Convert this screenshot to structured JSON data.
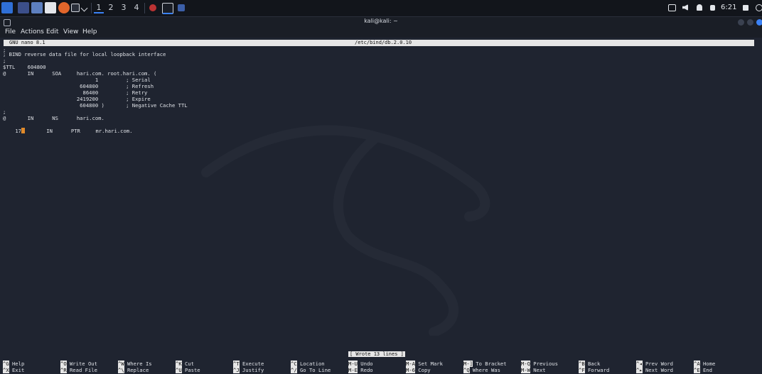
{
  "taskbar": {
    "workspaces": [
      "1",
      "2",
      "3",
      "4"
    ],
    "clock": "6:21"
  },
  "window": {
    "title": "kali@kali: ~",
    "menu": [
      "File",
      "Actions",
      "Edit",
      "View",
      "Help"
    ]
  },
  "nano": {
    "version": "GNU nano 8.1",
    "filename": "/etc/bind/db.2.0.10",
    "lines": [
      ";",
      "; BIND reverse data file for local loopback interface",
      ";",
      "$TTL    604800",
      "@       IN      SOA     hari.com. root.hari.com. (",
      "                              1         ; Serial",
      "                         604800         ; Refresh",
      "                          86400         ; Retry",
      "                        2419200         ; Expire",
      "                         604800 )       ; Negative Cache TTL",
      ";",
      "@       IN      NS      hari.com.",
      "IN      PTR     mr.hari.com."
    ],
    "ptr_prefix": "17",
    "status": "[ Wrote 13 lines ]",
    "shortcuts": [
      {
        "key1": "^G",
        "label1": "Help",
        "key2": "^X",
        "label2": "Exit"
      },
      {
        "key1": "^O",
        "label1": "Write Out",
        "key2": "^R",
        "label2": "Read File"
      },
      {
        "key1": "^W",
        "label1": "Where Is",
        "key2": "^\\",
        "label2": "Replace"
      },
      {
        "key1": "^K",
        "label1": "Cut",
        "key2": "^U",
        "label2": "Paste"
      },
      {
        "key1": "^T",
        "label1": "Execute",
        "key2": "^J",
        "label2": "Justify"
      },
      {
        "key1": "^C",
        "label1": "Location",
        "key2": "^/",
        "label2": "Go To Line"
      },
      {
        "key1": "M-U",
        "label1": "Undo",
        "key2": "M-E",
        "label2": "Redo"
      },
      {
        "key1": "M-A",
        "label1": "Set Mark",
        "key2": "M-6",
        "label2": "Copy"
      },
      {
        "key1": "M-]",
        "label1": "To Bracket",
        "key2": "^Q",
        "label2": "Where Was"
      },
      {
        "key1": "M-Q",
        "label1": "Previous",
        "key2": "M-W",
        "label2": "Next"
      },
      {
        "key1": "^B",
        "label1": "Back",
        "key2": "^F",
        "label2": "Forward"
      },
      {
        "key1": "^◂",
        "label1": "Prev Word",
        "key2": "^▸",
        "label2": "Next Word"
      },
      {
        "key1": "^A",
        "label1": "Home",
        "key2": "^E",
        "label2": "End"
      }
    ]
  }
}
